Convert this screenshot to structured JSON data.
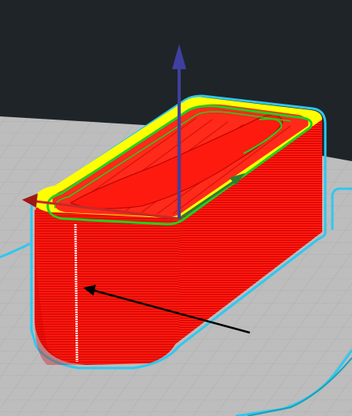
{
  "viewport": {
    "background_color": "#1f2428",
    "bed_color": "#bdbdbd",
    "bed_grid_color": "#a9a9a9"
  },
  "model": {
    "wall_color": "#ff1a0f",
    "wall_line_color": "#b30000",
    "top_infill_color": "#ffff00",
    "inner_perimeter_color": "#1fd11f",
    "outline_color": "#2ec8f0",
    "seam_color": "#ffffff",
    "seam_marker": "z-seam-dots"
  },
  "gizmo": {
    "x_axis_color": "#c62828",
    "y_axis_color": "#2e7d32",
    "z_axis_color": "#3f3fa0"
  },
  "annotation": {
    "arrow_color": "#000000",
    "arrow_icon": "pointer-arrow-icon"
  }
}
